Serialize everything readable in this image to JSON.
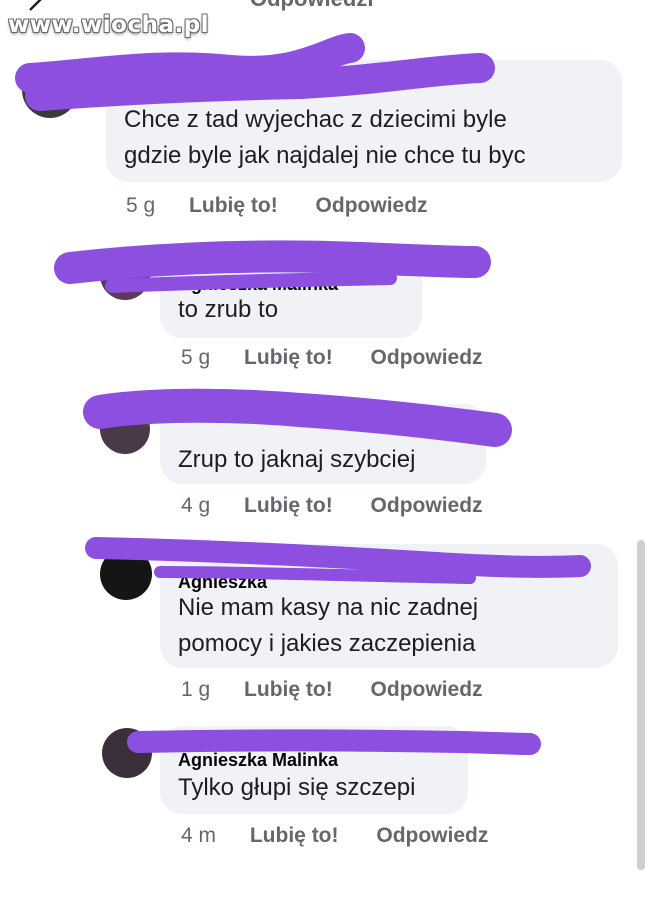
{
  "watermark": "www.wiocha.pl",
  "header": {
    "reply_label": "Odpowiedzi"
  },
  "comments": [
    {
      "author": "",
      "text_lines": [
        "Chce z tad wyjechac z dziecimi byle",
        "gdzie byle jak najdalej nie chce tu byc"
      ],
      "time": "5 g",
      "like": "Lubię to!",
      "reply": "Odpowiedz"
    },
    {
      "author": "Agnieszka Malinka",
      "text_lines": [
        "to zrub to"
      ],
      "time": "5 g",
      "like": "Lubię to!",
      "reply": "Odpowiedz"
    },
    {
      "author": "",
      "text_lines": [
        "Zrup to jaknaj szybciej"
      ],
      "time": "4 g",
      "like": "Lubię to!",
      "reply": "Odpowiedz"
    },
    {
      "author": "Agnieszka",
      "text_lines": [
        "Nie mam kasy na nic zadnej",
        "pomocy i jakies zaczepienia"
      ],
      "time": "1 g",
      "like": "Lubię to!",
      "reply": "Odpowiedz"
    },
    {
      "author": "Agnieszka Malinka",
      "text_lines": [
        "Tylko głupi się szczepi"
      ],
      "time": "4 m",
      "like": "Lubię to!",
      "reply": "Odpowiedz"
    }
  ],
  "colors": {
    "scribble": "#8c4fe0",
    "bubble": "#f0f2f5",
    "meta": "#65676b"
  }
}
